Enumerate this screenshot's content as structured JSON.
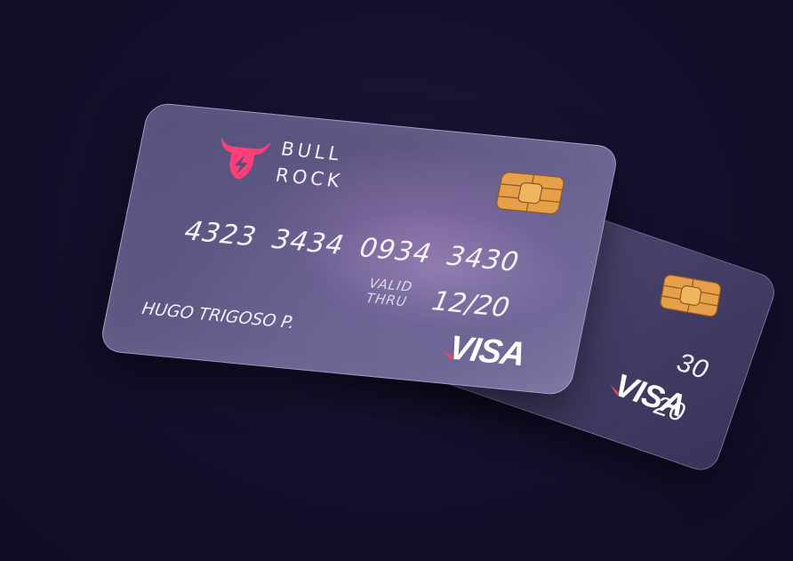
{
  "front_card": {
    "brand_line1": "BULL",
    "brand_line2": "ROCK",
    "number": "4323 3434 0934 3430",
    "valid_label_1": "VALID",
    "valid_label_2": "THRU",
    "expiry": "12/20",
    "holder": "HUGO TRIGOSO P.",
    "network": "VISA"
  },
  "back_card": {
    "number_fragment": "30",
    "expiry_fragment": "20",
    "network": "VISA"
  },
  "colors": {
    "background": "#130f2b",
    "logo_pink": "#ff3e7a",
    "chip_gold": "#e8a24a",
    "visa_swoosh": "#f0445a"
  }
}
